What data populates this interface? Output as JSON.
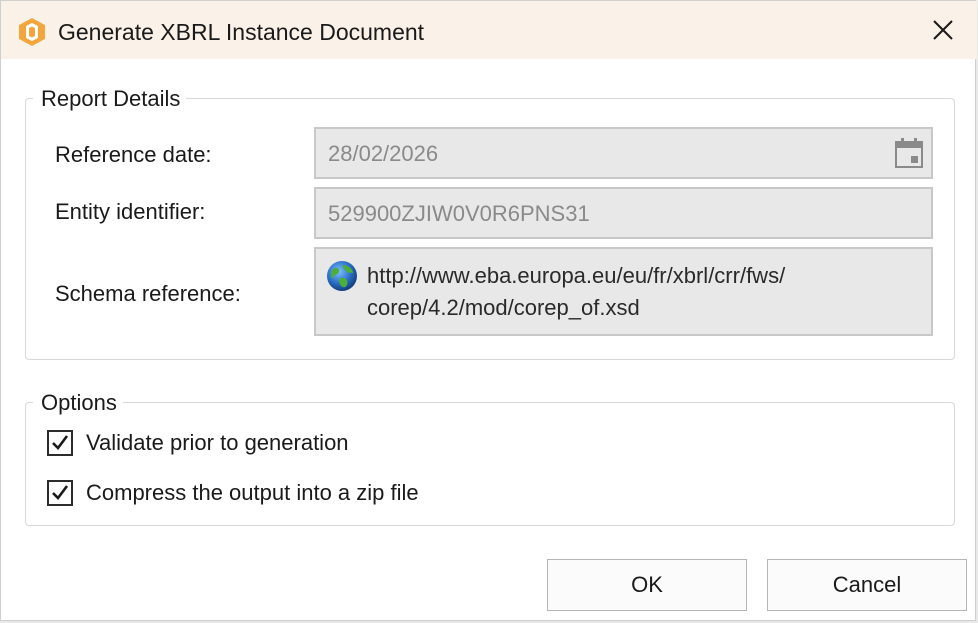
{
  "window": {
    "title": "Generate XBRL Instance Document",
    "accent_color": "#f0a030"
  },
  "report_details": {
    "legend": "Report Details",
    "reference_date": {
      "label": "Reference date:",
      "value": "28/02/2026"
    },
    "entity_identifier": {
      "label": "Entity identifier:",
      "value": "529900ZJIW0V0R6PNS31"
    },
    "schema_reference": {
      "label": "Schema reference:",
      "value_line1": "http://www.eba.europa.eu/eu/fr/xbrl/crr/fws/",
      "value_line2": "corep/4.2/mod/corep_of.xsd"
    }
  },
  "options": {
    "legend": "Options",
    "validate": {
      "label": "Validate prior to generation",
      "checked": true
    },
    "compress": {
      "label": "Compress the output into a zip file",
      "checked": true
    }
  },
  "buttons": {
    "ok": "OK",
    "cancel": "Cancel"
  }
}
